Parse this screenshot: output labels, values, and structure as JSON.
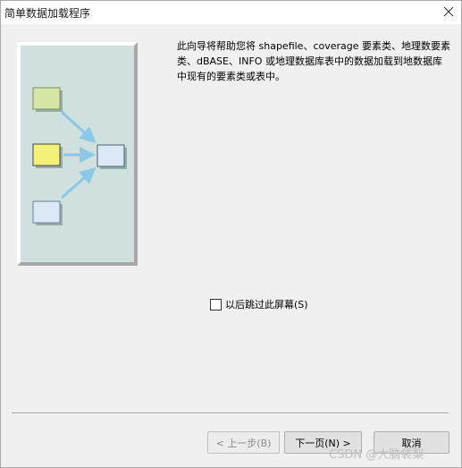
{
  "window": {
    "title": "简单数据加载程序"
  },
  "main": {
    "description": "此向导将帮助您将 shapefile、coverage 要素类、地理数要素类、dBASE、INFO 或地理数据库表中的数据加载到地数据库中现有的要素类或表中。"
  },
  "options": {
    "skip_screen_label": "以后跳过此屏幕(S)",
    "skip_screen_checked": false
  },
  "footer": {
    "back_label": "< 上一步(B)",
    "next_label": "下一页(N) >",
    "cancel_label": "取消"
  },
  "watermark": "CSDN @大脑袋梨",
  "colors": {
    "panel_bg": "#cfe0df",
    "box_green": "#d6e6a6",
    "box_yellow": "#f4f27a",
    "box_blue": "#dde8f6",
    "arrow": "#8ac8e6"
  },
  "icons": {
    "close": "close-icon"
  }
}
